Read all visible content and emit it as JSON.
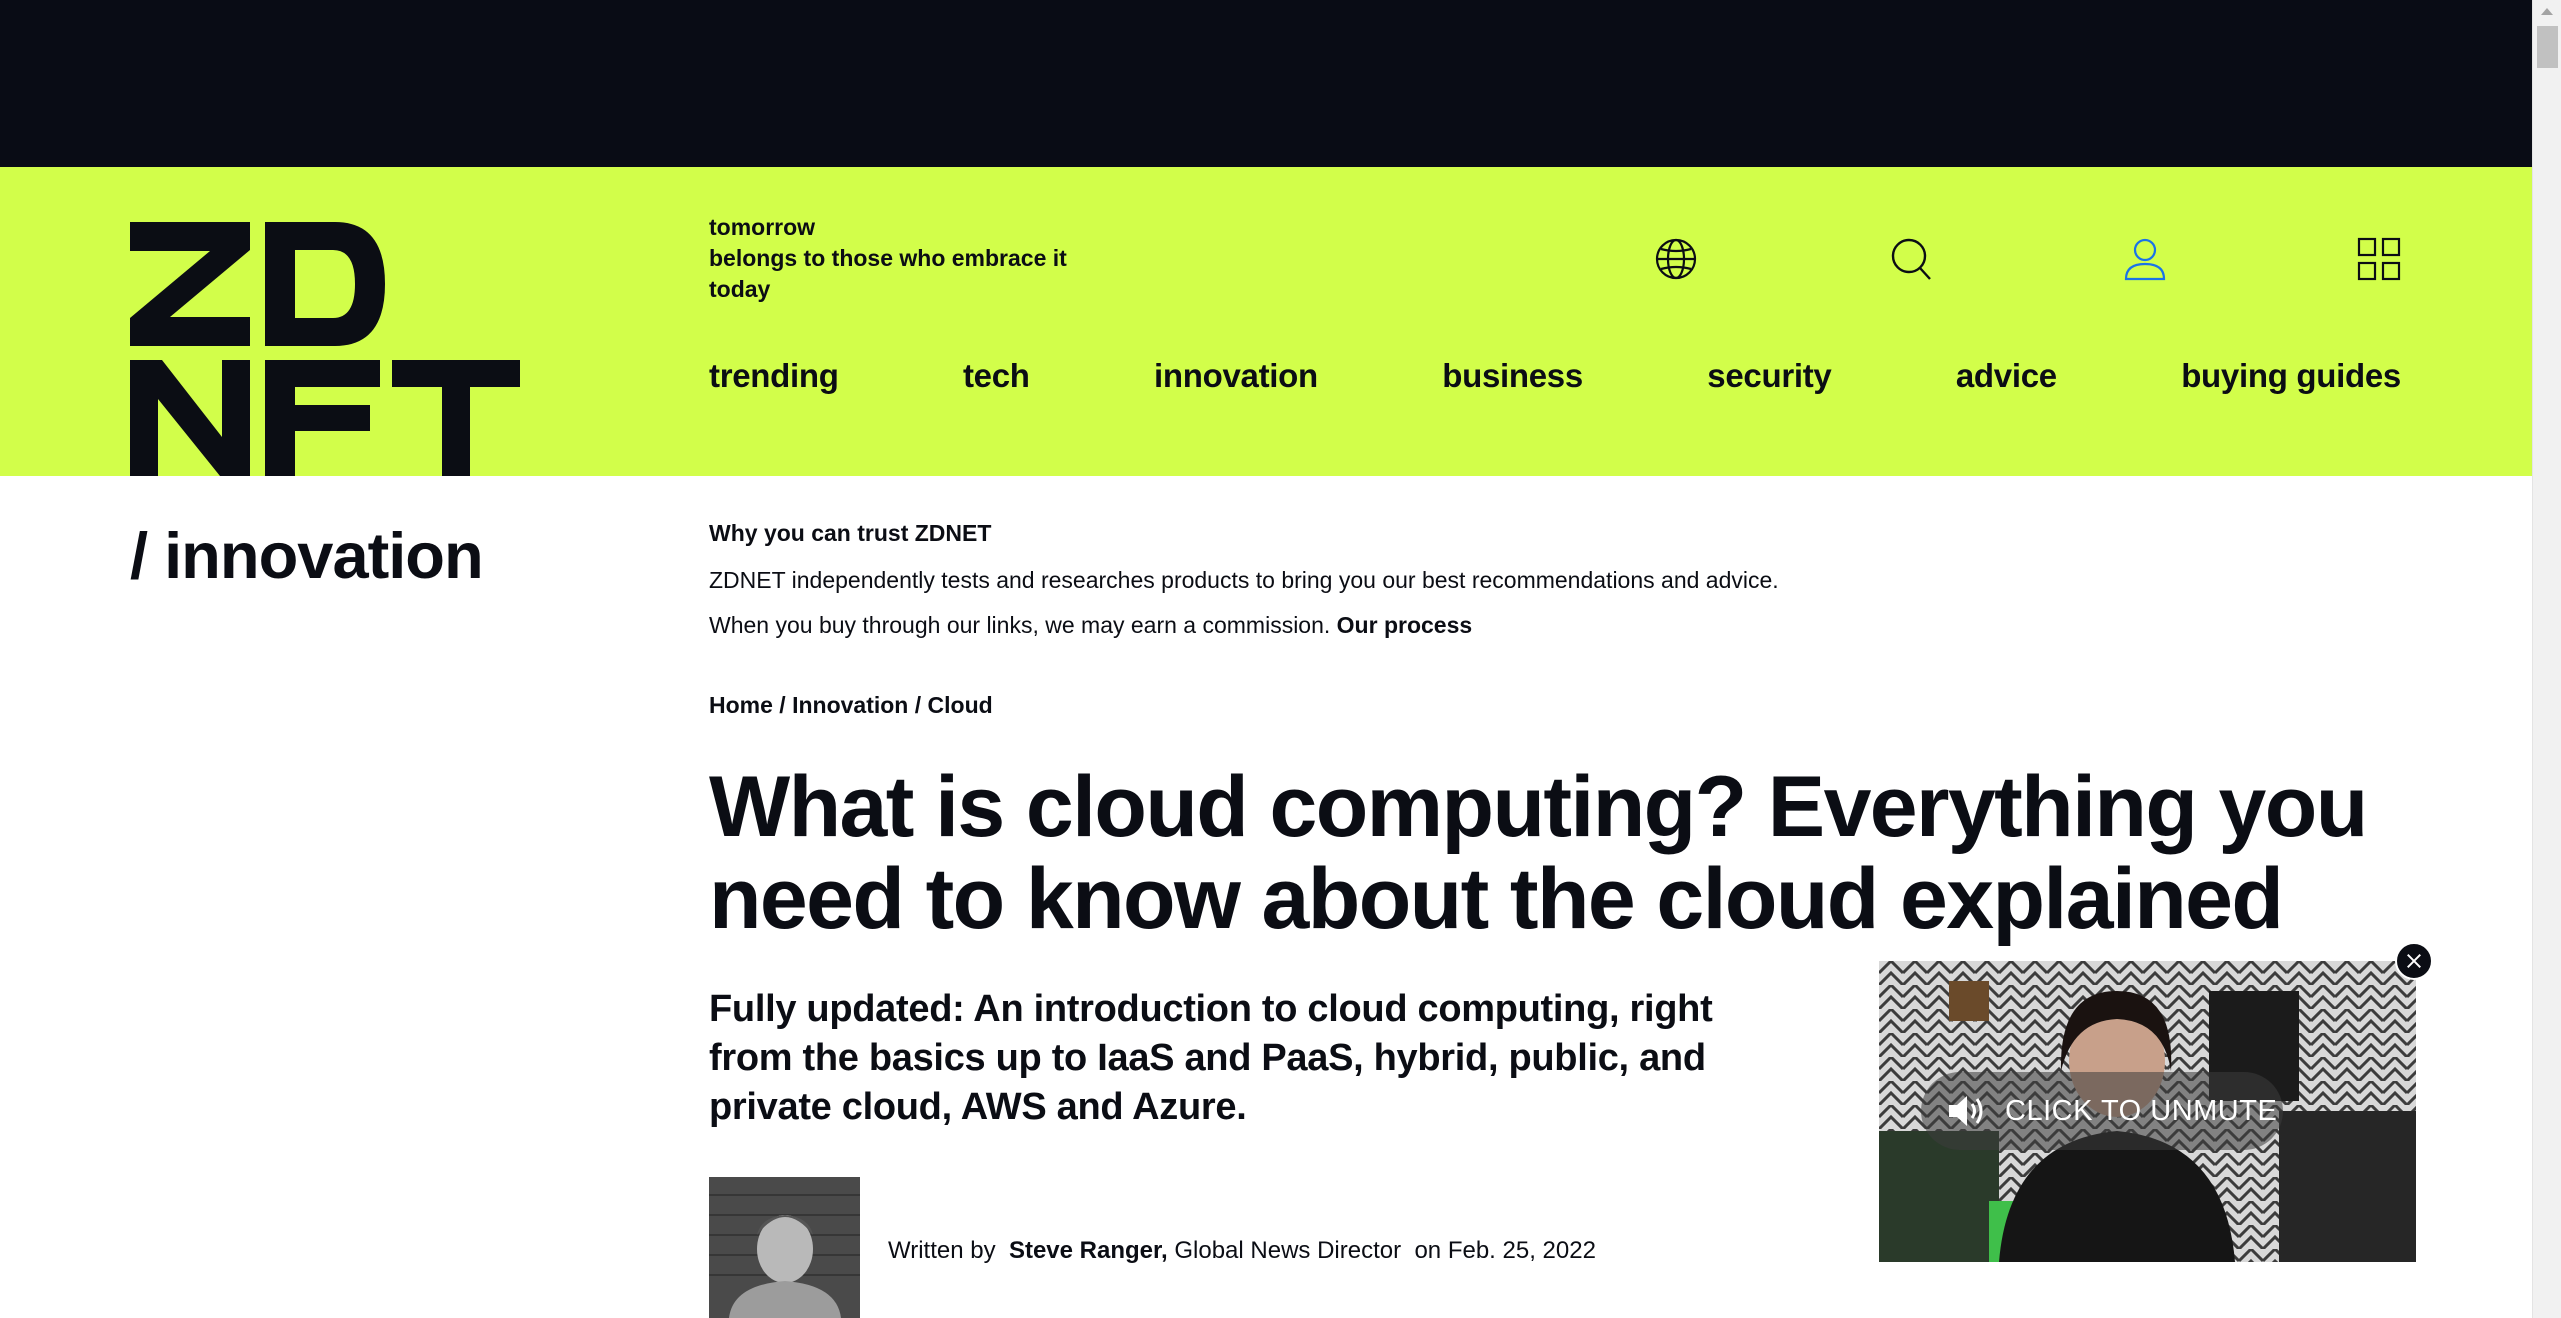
{
  "header": {
    "tagline": [
      "tomorrow",
      "belongs to those who embrace it",
      "today"
    ],
    "nav": [
      "trending",
      "tech",
      "innovation",
      "business",
      "security",
      "advice",
      "buying guides"
    ]
  },
  "icons": {
    "edition": "globe-icon",
    "search": "search-icon",
    "account": "user-icon",
    "menu": "grid-menu-icon"
  },
  "colors": {
    "brand_lime": "#d2fe4a",
    "ink": "#0b0d14",
    "top_bar": "#090c15",
    "account_icon": "#1a73e8"
  },
  "section": {
    "label": "/ innovation"
  },
  "trust": {
    "title": "Why you can trust ZDNET",
    "line1": "ZDNET independently tests and researches products to bring you our best recommendations and advice.",
    "line2": "When you buy through our links, we may earn a commission.",
    "process_link": "Our process"
  },
  "breadcrumb": {
    "home": "Home",
    "sep": "/",
    "section": "Innovation",
    "topic": "Cloud"
  },
  "article": {
    "headline": "What is cloud computing? Everything you need to know about the cloud explained",
    "subhead": "Fully updated: An introduction to cloud computing, right from the basics up to IaaS and PaaS, hybrid, public, and private cloud, AWS and Azure.",
    "written_by": "Written by",
    "author": "Steve Ranger,",
    "author_title": "Global News Director",
    "date_prefix": "on",
    "date": "Feb. 25, 2022"
  },
  "video": {
    "unmute_label": "CLICK TO UNMUTE"
  }
}
